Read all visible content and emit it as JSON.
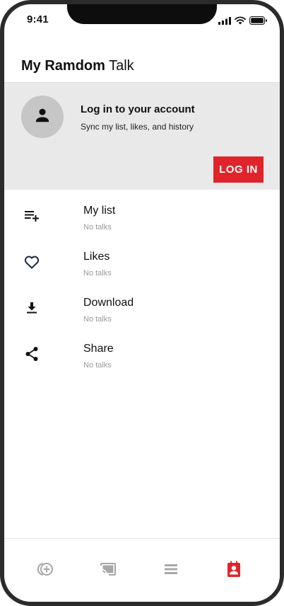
{
  "status_bar": {
    "time": "9:41",
    "icons": [
      "signal-icon",
      "wifi-icon",
      "battery-icon"
    ]
  },
  "header": {
    "title_bold": "My Ramdom",
    "title_regular": "Talk"
  },
  "login": {
    "title": "Log in to your account",
    "subtitle": "Sync my list, likes, and history",
    "button_label": "LOG IN",
    "avatar_icon": "person-icon"
  },
  "menu": {
    "items": [
      {
        "label": "My list",
        "sub": "No talks",
        "icon": "playlist-add-icon"
      },
      {
        "label": "Likes",
        "sub": "No talks",
        "icon": "heart-icon"
      },
      {
        "label": "Download",
        "sub": "No talks",
        "icon": "download-icon"
      },
      {
        "label": "Share",
        "sub": "No talks",
        "icon": "share-icon"
      }
    ]
  },
  "bottom_nav": {
    "items": [
      {
        "icon": "add-circle-icon",
        "active": false
      },
      {
        "icon": "cast-icon",
        "active": false
      },
      {
        "icon": "menu-lines-icon",
        "active": false
      },
      {
        "icon": "profile-contact-icon",
        "active": true
      }
    ],
    "active_color": "#e0242b",
    "inactive_color": "#a8a8a8"
  },
  "colors": {
    "accent": "#e0242b",
    "panel_bg": "#e9e9e9",
    "avatar_bg": "#c6c6c6",
    "icon_dark": "#1f2a44"
  }
}
